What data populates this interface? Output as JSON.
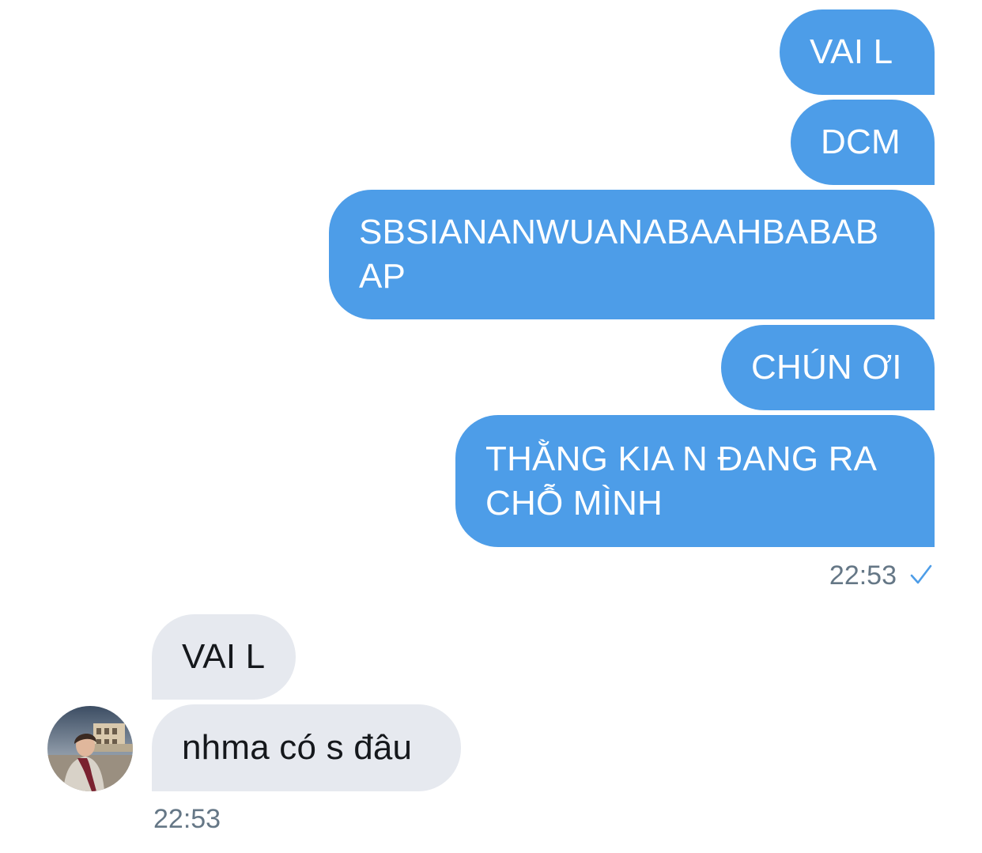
{
  "conversation": {
    "outgoing_messages": [
      "VAI L",
      "DCM",
      "SBSIANANWUANABAAHBABAB\nAP",
      "CHÚN ƠI",
      "THẰNG KIA N ĐANG RA\nCHỖ MÌNH"
    ],
    "outgoing_timestamp": "22:53",
    "outgoing_status_icon": "checkmark-icon",
    "incoming_messages": [
      "VAI L",
      "nhma có s đâu"
    ],
    "incoming_timestamp": "22:53",
    "incoming_avatar_icon": "user-avatar"
  },
  "colors": {
    "outgoing_bubble": "#4d9de8",
    "incoming_bubble": "#e6e9ef",
    "timestamp": "#657786",
    "checkmark": "#4d9de8"
  }
}
